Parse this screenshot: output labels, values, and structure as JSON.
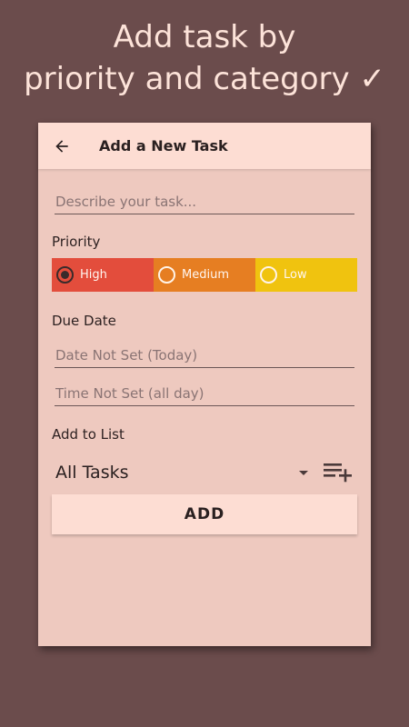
{
  "promo": {
    "line1": "Add task by",
    "line2": "priority and category ✓"
  },
  "appbar": {
    "back_icon": "arrow-left-icon",
    "title": "Add a New Task"
  },
  "task_field": {
    "placeholder": "Describe your task...",
    "value": ""
  },
  "priority": {
    "label": "Priority",
    "selected": "High",
    "options": [
      {
        "label": "High",
        "color": "#e34d3c"
      },
      {
        "label": "Medium",
        "color": "#e67e22"
      },
      {
        "label": "Low",
        "color": "#f0c30f"
      }
    ]
  },
  "due_date": {
    "label": "Due Date",
    "date_placeholder": "Date Not Set (Today)",
    "time_placeholder": "Time Not Set (all day)"
  },
  "add_to_list": {
    "label": "Add to List",
    "selected": "All Tasks",
    "add_list_icon": "playlist-add-icon"
  },
  "add_button": {
    "label": "ADD"
  },
  "colors": {
    "background": "#6b4c4c",
    "card": "#eec9bf",
    "appbar": "#fdddd3"
  }
}
